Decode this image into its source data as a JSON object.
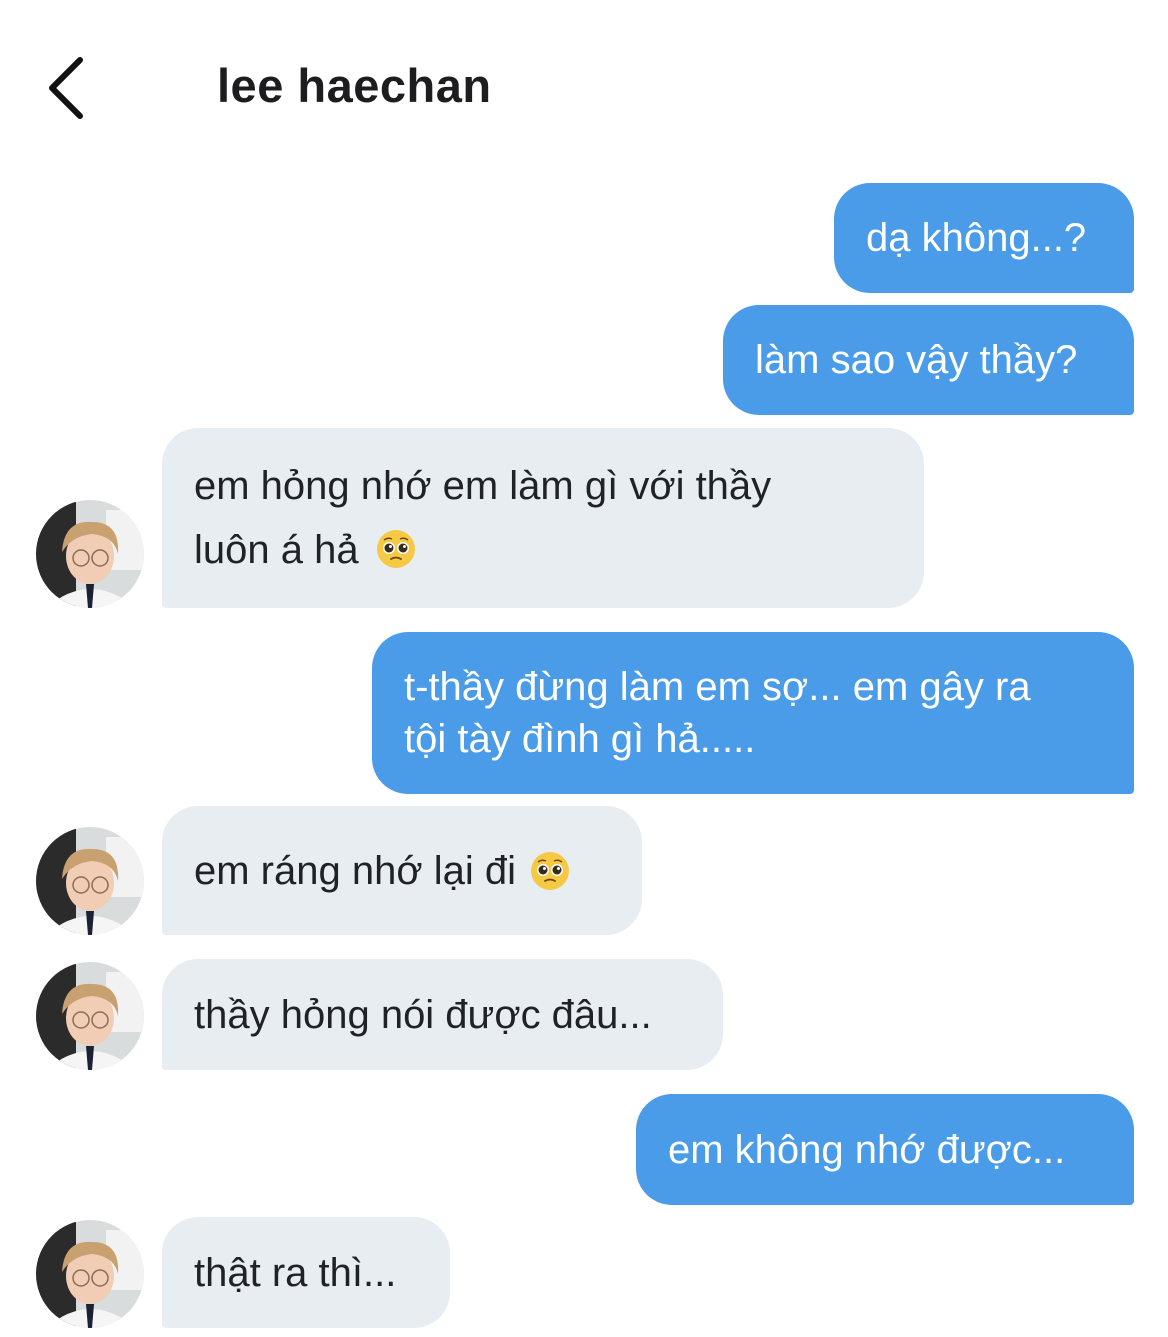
{
  "header": {
    "back_icon": "chevron-left-icon",
    "title": "lee haechan"
  },
  "messages": [
    {
      "from": "me",
      "text": "dạ không...?"
    },
    {
      "from": "me",
      "text": "làm sao vậy thầy?"
    },
    {
      "from": "them",
      "line1": "em hỏng nhớ em làm gì với thầy",
      "line2": "luôn á hả",
      "emoji": "pleading-face"
    },
    {
      "from": "me",
      "line1": "t-thầy đừng làm em sợ... em gây ra",
      "line2": "tội tày đình gì hả....."
    },
    {
      "from": "them",
      "text": "em ráng nhớ lại đi",
      "emoji": "pleading-face"
    },
    {
      "from": "them",
      "text": "thầy hỏng nói được đâu..."
    },
    {
      "from": "me",
      "text": "em không nhớ được..."
    },
    {
      "from": "them",
      "text": "thật ra thì..."
    }
  ],
  "colors": {
    "outgoing_bubble": "#4a9be8",
    "incoming_bubble": "#e8edf2",
    "background": "#ffffff"
  }
}
